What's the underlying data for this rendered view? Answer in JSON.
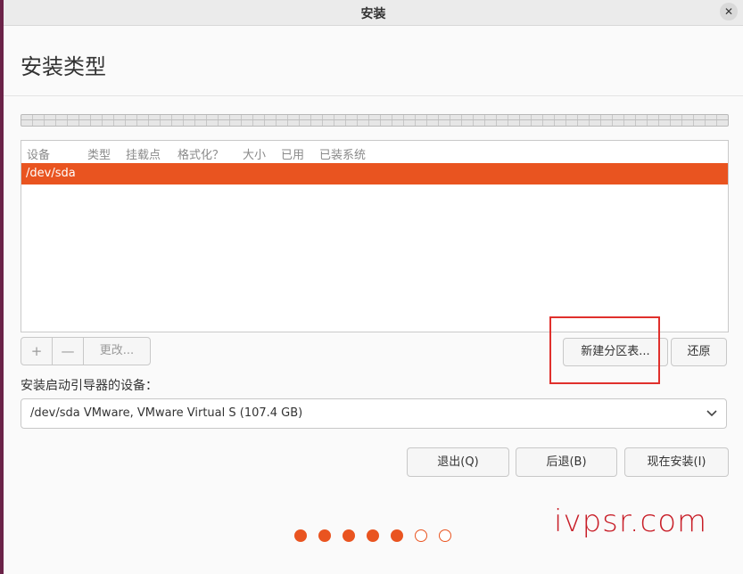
{
  "window": {
    "title": "安装",
    "close_icon": "close-icon"
  },
  "page": {
    "heading": "安装类型"
  },
  "partition_table": {
    "columns": [
      "设备",
      "类型",
      "挂载点",
      "格式化？",
      "大小",
      "已用",
      "已装系统"
    ],
    "rows": [
      {
        "device": "/dev/sda",
        "selected": true
      }
    ]
  },
  "partition_actions": {
    "add_label": "+",
    "remove_label": "—",
    "change_label": "更改...",
    "new_table_label": "新建分区表...",
    "revert_label": "还原"
  },
  "bootloader": {
    "label": "安装启动引导器的设备：",
    "selected_device": "/dev/sda VMware, VMware Virtual S (107.4 GB)"
  },
  "navigation": {
    "quit_label": "退出(Q)",
    "back_label": "后退(B)",
    "install_label": "现在安装(I)"
  },
  "progress": {
    "total_steps": 7,
    "completed_steps": 5
  },
  "watermark": "ivpsr.com",
  "colors": {
    "accent": "#e95420",
    "highlight_box": "#e0302c",
    "watermark": "#c81e28"
  }
}
